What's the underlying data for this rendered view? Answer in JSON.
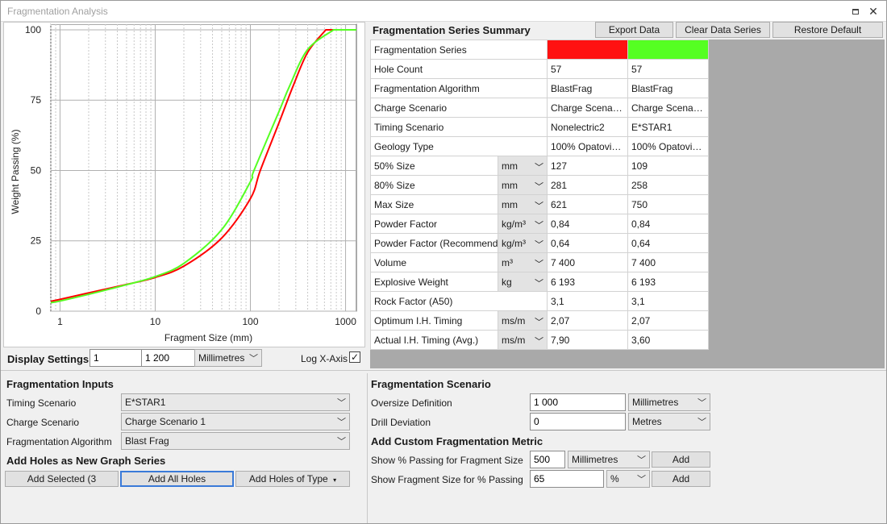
{
  "window": {
    "title": "Fragmentation Analysis"
  },
  "chart_data": {
    "type": "line",
    "xscale": "log",
    "xlim": [
      0.8,
      1300
    ],
    "ylim": [
      0,
      102
    ],
    "xlabel": "Fragment Size (mm)",
    "ylabel": "Weight Passing (%)",
    "xticks": [
      1,
      10,
      100,
      1000
    ],
    "xtick_labels": [
      "1",
      "10",
      "100",
      "1000"
    ],
    "yticks": [
      0,
      25,
      50,
      75,
      100
    ],
    "ytick_labels": [
      "0",
      "25",
      "50",
      "75",
      "100"
    ],
    "grid": true,
    "series": [
      {
        "color": "#ff0000",
        "x": [
          0.8,
          1,
          2,
          5,
          10,
          20,
          50,
          100,
          127,
          200,
          281,
          400,
          621
        ],
        "y": [
          3.5,
          4.2,
          6.5,
          9.5,
          12,
          16,
          26,
          40,
          50,
          67,
          80,
          92,
          100
        ]
      },
      {
        "color": "#55ff22",
        "x": [
          0.8,
          1,
          2,
          5,
          10,
          20,
          50,
          100,
          109,
          200,
          258,
          400,
          750
        ],
        "y": [
          3,
          3.6,
          6,
          9.4,
          12.3,
          17,
          29,
          46,
          50,
          71,
          80,
          93,
          100
        ]
      }
    ]
  },
  "display": {
    "label": "Display Settings",
    "min": "1",
    "max": "1 200",
    "units": "Millimetres",
    "log_label": "Log X-Axis",
    "log_checked": "✓"
  },
  "summary": {
    "title": "Fragmentation Series Summary",
    "export_label": "Export Data",
    "clear_label": "Clear Data Series",
    "restore_label": "Restore Default",
    "series_colors": [
      "#ff1111",
      "#55ff22"
    ],
    "rows": [
      {
        "label": "Fragmentation Series",
        "values": [
          "",
          ""
        ]
      },
      {
        "label": "Hole Count",
        "values": [
          "57",
          "57"
        ]
      },
      {
        "label": "Fragmentation Algorithm",
        "values": [
          "BlastFrag",
          "BlastFrag"
        ]
      },
      {
        "label": "Charge Scenario",
        "values": [
          "Charge Scena…",
          "Charge Scena…"
        ]
      },
      {
        "label": "Timing Scenario",
        "values": [
          "Nonelectric2",
          "E*STAR1"
        ]
      },
      {
        "label": "Geology Type",
        "values": [
          "100% Opatovi…",
          "100% Opatovi…"
        ]
      },
      {
        "label": "50% Size",
        "unit": "mm",
        "values": [
          "127",
          "109"
        ]
      },
      {
        "label": "80% Size",
        "unit": "mm",
        "values": [
          "281",
          "258"
        ]
      },
      {
        "label": "Max Size",
        "unit": "mm",
        "values": [
          "621",
          "750"
        ]
      },
      {
        "label": "Powder Factor",
        "unit": "kg/m³",
        "values": [
          "0,84",
          "0,84"
        ]
      },
      {
        "label": "Powder Factor (Recommended)",
        "unit": "kg/m³",
        "values": [
          "0,64",
          "0,64"
        ]
      },
      {
        "label": "Volume",
        "unit": "m³",
        "values": [
          "7 400",
          "7 400"
        ]
      },
      {
        "label": "Explosive Weight",
        "unit": "kg",
        "values": [
          "6 193",
          "6 193"
        ]
      },
      {
        "label": "Rock Factor (A50)",
        "values": [
          "3,1",
          "3,1"
        ]
      },
      {
        "label": "Optimum I.H. Timing",
        "unit": "ms/m",
        "values": [
          "2,07",
          "2,07"
        ]
      },
      {
        "label": "Actual I.H. Timing (Avg.)",
        "unit": "ms/m",
        "values": [
          "7,90",
          "3,60"
        ]
      }
    ]
  },
  "inputs": {
    "title": "Fragmentation Inputs",
    "timing_label": "Timing Scenario",
    "timing_value": "E*STAR1",
    "charge_label": "Charge Scenario",
    "charge_value": "Charge Scenario 1",
    "algo_label": "Fragmentation Algorithm",
    "algo_value": "Blast Frag"
  },
  "add_holes": {
    "title": "Add Holes as New Graph Series",
    "selected_label": "Add Selected (3",
    "all_label": "Add All Holes",
    "type_label": "Add Holes of Type"
  },
  "scenario": {
    "title": "Fragmentation Scenario",
    "oversize_label": "Oversize Definition",
    "oversize_value": "1 000",
    "oversize_unit": "Millimetres",
    "drill_label": "Drill Deviation",
    "drill_value": "0",
    "drill_unit": "Metres"
  },
  "metric": {
    "title": "Add Custom Fragmentation Metric",
    "passing_label": "Show % Passing for Fragment Size",
    "passing_value": "500",
    "passing_unit": "Millimetres",
    "passing_add": "Add",
    "size_label": "Show Fragment Size for % Passing",
    "size_value": "65",
    "size_unit": "%",
    "size_add": "Add"
  }
}
